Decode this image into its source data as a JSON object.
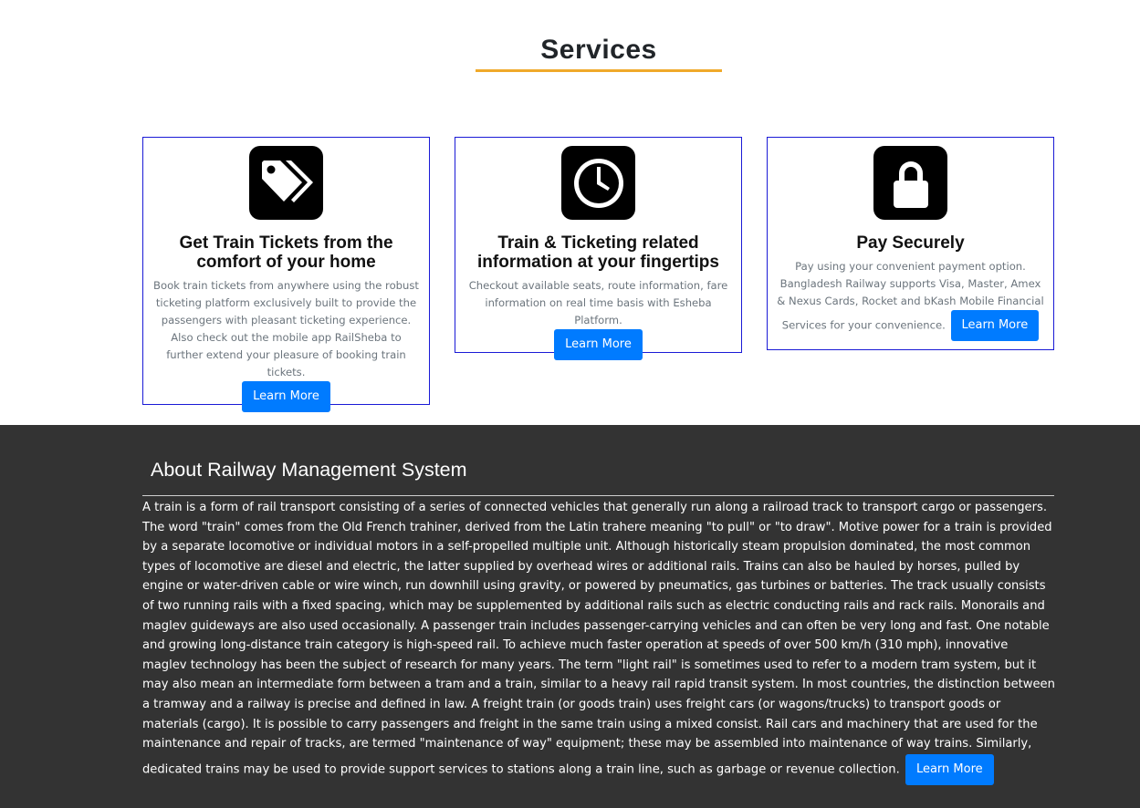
{
  "services": {
    "title": "Services",
    "accent_color": "#f0a92a",
    "cards": [
      {
        "icon": "tags-icon",
        "title": "Get Train Tickets from the comfort of your home",
        "text": "Book train tickets from anywhere using the robust ticketing platform exclusively built to provide the passengers with pleasant ticketing experience. Also check out the mobile app RailSheba to further extend your pleasure of booking train tickets.",
        "button": "Learn More"
      },
      {
        "icon": "clock-icon",
        "title": "Train & Ticketing related information at your fingertips",
        "text": "Checkout available seats, route information, fare information on real time basis with Esheba Platform.",
        "button": "Learn More"
      },
      {
        "icon": "lock-icon",
        "title": "Pay Securely",
        "text": "Pay using your convenient payment option. Bangladesh Railway supports Visa, Master, Amex & Nexus Cards, Rocket and bKash Mobile Financial Services for your convenience.",
        "button": "Learn More"
      }
    ]
  },
  "about": {
    "title": "About Railway Management System",
    "text": "A train is a form of rail transport consisting of a series of connected vehicles that generally run along a railroad track to transport cargo or passengers. The word \"train\" comes from the Old French trahiner, derived from the Latin trahere meaning \"to pull\" or \"to draw\". Motive power for a train is provided by a separate locomotive or individual motors in a self-propelled multiple unit. Although historically steam propulsion dominated, the most common types of locomotive are diesel and electric, the latter supplied by overhead wires or additional rails. Trains can also be hauled by horses, pulled by engine or water-driven cable or wire winch, run downhill using gravity, or powered by pneumatics, gas turbines or batteries. The track usually consists of two running rails with a fixed spacing, which may be supplemented by additional rails such as electric conducting rails and rack rails. Monorails and maglev guideways are also used occasionally. A passenger train includes passenger-carrying vehicles and can often be very long and fast. One notable and growing long-distance train category is high-speed rail. To achieve much faster operation at speeds of over 500 km/h (310 mph), innovative maglev technology has been the subject of research for many years. The term \"light rail\" is sometimes used to refer to a modern tram system, but it may also mean an intermediate form between a tram and a train, similar to a heavy rail rapid transit system. In most countries, the distinction between a tramway and a railway is precise and defined in law. A freight train (or goods train) uses freight cars (or wagons/trucks) to transport goods or materials (cargo). It is possible to carry passengers and freight in the same train using a mixed consist. Rail cars and machinery that are used for the maintenance and repair of tracks, are termed \"maintenance of way\" equipment; these may be assembled into maintenance of way trains. Similarly, dedicated trains may be used to provide support services to stations along a train line, such as garbage or revenue collection.",
    "button": "Learn More",
    "background_color": "#333333"
  },
  "colors": {
    "button": "#007bff",
    "card_border": "#1a1ad6"
  }
}
